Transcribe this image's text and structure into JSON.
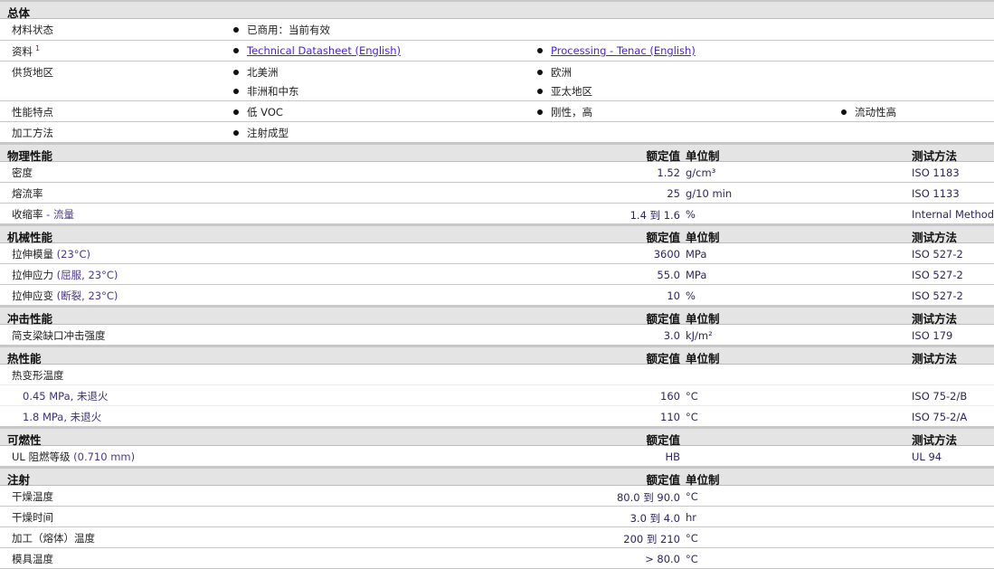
{
  "general": {
    "title": "总体",
    "rows": [
      {
        "label": "材料状态",
        "cols": [
          [
            {
              "text": "已商用：当前有效"
            }
          ]
        ]
      },
      {
        "label": "资料",
        "sup": "1",
        "cols": [
          [
            {
              "text": "Technical Datasheet (English)",
              "link": true
            }
          ],
          [
            {
              "text": "Processing - Tenac (English)",
              "link": true
            }
          ]
        ]
      },
      {
        "label": "供货地区",
        "cols": [
          [
            {
              "text": "北美洲"
            },
            {
              "text": "非洲和中东"
            }
          ],
          [
            {
              "text": "欧洲"
            },
            {
              "text": "亚太地区"
            }
          ]
        ]
      },
      {
        "label": "性能特点",
        "cols": [
          [
            {
              "text": "低  VOC"
            }
          ],
          [
            {
              "text": "刚性，高"
            }
          ],
          [
            {
              "text": "流动性高"
            }
          ]
        ]
      },
      {
        "label": "加工方法",
        "cols": [
          [
            {
              "text": "注射成型"
            }
          ]
        ]
      }
    ]
  },
  "sections": [
    {
      "title": "物理性能",
      "hv": "额定值",
      "hu": "单位制",
      "hm": "测试方法",
      "rows": [
        {
          "label": "密度",
          "value": "1.52",
          "unit": "g/cm³",
          "method": "ISO 1183"
        },
        {
          "label": "熔流率",
          "value": "25",
          "unit": "g/10 min",
          "method": "ISO 1133"
        },
        {
          "label": "收缩率",
          "note": " - 流量",
          "value": "1.4 到  1.6",
          "unit": "%",
          "method": "Internal Method"
        }
      ]
    },
    {
      "title": "机械性能",
      "hv": "额定值",
      "hu": "单位制",
      "hm": "测试方法",
      "rows": [
        {
          "label": "拉伸模量",
          "note": "(23°C)",
          "value": "3600",
          "unit": "MPa",
          "method": "ISO 527-2"
        },
        {
          "label": "拉伸应力",
          "note": "(屈服, 23°C)",
          "value": "55.0",
          "unit": "MPa",
          "method": "ISO 527-2"
        },
        {
          "label": "拉伸应变",
          "note": "(断裂, 23°C)",
          "value": "10",
          "unit": "%",
          "method": "ISO 527-2"
        }
      ]
    },
    {
      "title": "冲击性能",
      "hv": "额定值",
      "hu": "单位制",
      "hm": "测试方法",
      "rows": [
        {
          "label": "简支梁缺口冲击强度",
          "value": "3.0",
          "unit": "kJ/m²",
          "method": "ISO 179"
        }
      ]
    },
    {
      "title": "热性能",
      "hv": "额定值",
      "hu": "单位制",
      "hm": "测试方法",
      "rows": [
        {
          "label": "热变形温度",
          "light": true
        },
        {
          "label": "0.45 MPa, 未退火",
          "indent": true,
          "light": true,
          "value": "160",
          "unit": "°C",
          "method": "ISO 75-2/B"
        },
        {
          "label": "1.8 MPa, 未退火",
          "indent": true,
          "value": "110",
          "unit": "°C",
          "method": "ISO 75-2/A"
        }
      ]
    },
    {
      "title": "可燃性",
      "hv": "额定值",
      "hm": "测试方法",
      "rows": [
        {
          "label": "UL 阻燃等级",
          "note": "(0.710 mm)",
          "value": "HB",
          "method": "UL 94"
        }
      ]
    },
    {
      "title": "注射",
      "hv": "额定值",
      "hu": "单位制",
      "rows": [
        {
          "label": "干燥温度",
          "value": "80.0 到  90.0",
          "unit": "°C"
        },
        {
          "label": "干燥时间",
          "value": "3.0 到  4.0",
          "unit": "hr"
        },
        {
          "label": "加工（熔体）温度",
          "value": "200 到  210",
          "unit": "°C"
        },
        {
          "label": "模具温度",
          "value": "> 80.0",
          "unit": "°C"
        }
      ]
    }
  ]
}
